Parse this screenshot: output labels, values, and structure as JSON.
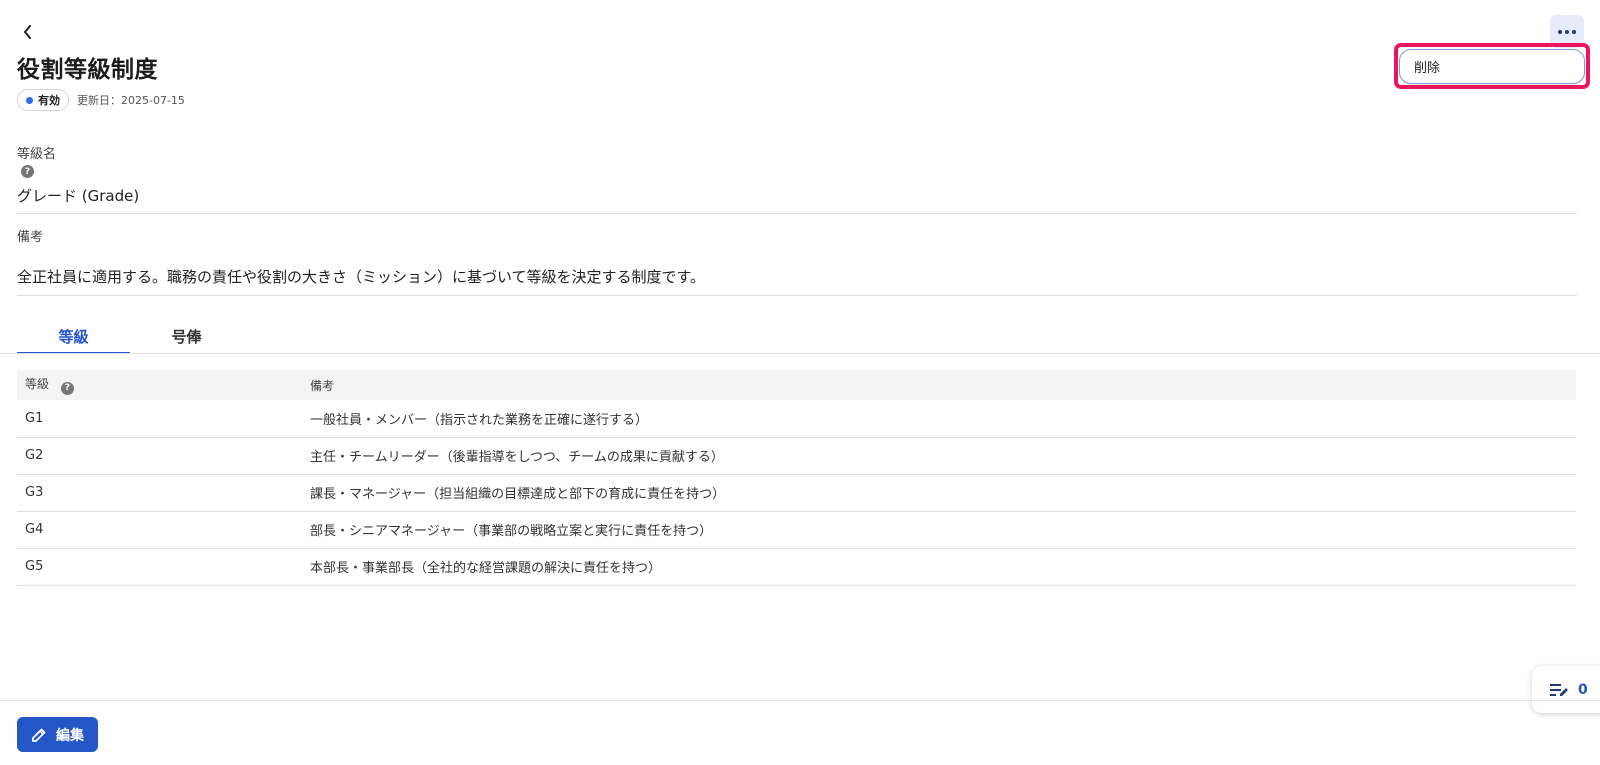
{
  "header": {
    "title": "役割等級制度",
    "status_label": "有効",
    "status_color": "#2a6ee8",
    "updated_label": "更新日：2025-07-15"
  },
  "menu": {
    "delete_label": "削除"
  },
  "fields": {
    "grade_name_label": "等級名",
    "grade_name_value": "グレード (Grade)",
    "remarks_label": "備考",
    "remarks_value": "全正社員に適用する。職務の責任や役割の大きさ（ミッション）に基づいて等級を決定する制度です。"
  },
  "tabs": [
    {
      "label": "等級",
      "active": true
    },
    {
      "label": "号俸",
      "active": false
    }
  ],
  "table": {
    "headers": [
      "等級",
      "備考"
    ],
    "rows": [
      [
        "G1",
        "一般社員・メンバー（指示された業務を正確に遂行する）"
      ],
      [
        "G2",
        "主任・チームリーダー（後輩指導をしつつ、チームの成果に貢献する）"
      ],
      [
        "G3",
        "課長・マネージャー（担当組織の目標達成と部下の育成に責任を持つ）"
      ],
      [
        "G4",
        "部長・シニアマネージャー（事業部の戦略立案と実行に責任を持つ）"
      ],
      [
        "G5",
        "本部長・事業部長（全社的な経営課題の解決に責任を持つ）"
      ]
    ]
  },
  "footer": {
    "edit_label": "編集",
    "notes_count": "0"
  },
  "icons": {
    "back": "chevron-left-icon",
    "more": "more-horizontal-icon",
    "help": "help-circle-icon",
    "edit": "pencil-icon",
    "notes": "notes-edit-icon"
  },
  "colors": {
    "accent": "#2456c8",
    "highlight": "#f0145a"
  }
}
